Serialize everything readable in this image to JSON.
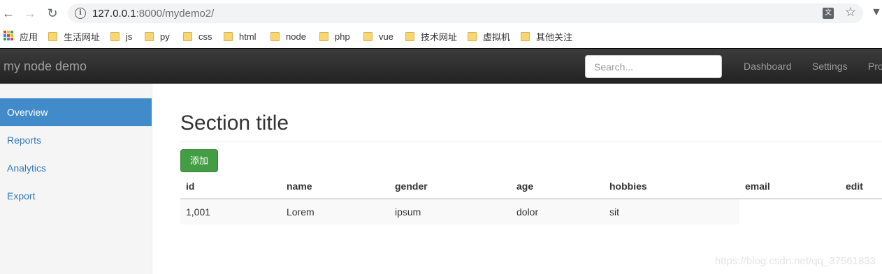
{
  "browser": {
    "url_host": "127.0.0.1",
    "url_rest": ":8000/mydemo2/",
    "translate_icon": "文",
    "bookmarks": [
      "应用",
      "生活网址",
      "js",
      "py",
      "css",
      "html",
      "node",
      "php",
      "vue",
      "技术网址",
      "虚拟机",
      "其他关注"
    ]
  },
  "navbar": {
    "brand": "my node demo",
    "search_placeholder": "Search...",
    "links": [
      "Dashboard",
      "Settings",
      "Pro"
    ]
  },
  "sidebar": {
    "items": [
      {
        "label": "Overview"
      },
      {
        "label": "Reports"
      },
      {
        "label": "Analytics"
      },
      {
        "label": "Export"
      }
    ]
  },
  "main": {
    "title": "Section title",
    "add_label": "添加",
    "table": {
      "headers": [
        "id",
        "name",
        "gender",
        "age",
        "hobbies",
        "email",
        "edit"
      ],
      "rows": [
        [
          "1,001",
          "Lorem",
          "ipsum",
          "dolor",
          "sit"
        ]
      ]
    }
  },
  "watermark": "https://blog.csdn.net/qq_37561833"
}
